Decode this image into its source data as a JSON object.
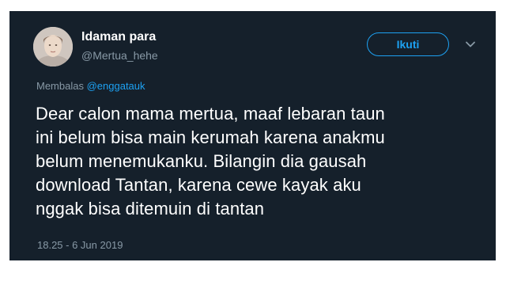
{
  "user": {
    "display_name": "Idaman para",
    "handle": "@Mertua_hehe"
  },
  "follow_button": {
    "label": "Ikuti"
  },
  "menu": {
    "icon": "chevron-down-icon"
  },
  "reply": {
    "prefix": "Membalas",
    "mention": "@enggatauk"
  },
  "tweet": {
    "text": "Dear calon mama mertua, maaf lebaran taun\nini belum bisa main kerumah karena anakmu\nbelum menemukanku. Bilangin dia gausah\ndownload Tantan, karena cewe kayak aku\nnggak bisa ditemuin di tantan",
    "timestamp": "18.25 - 6 Jun 2019"
  },
  "colors": {
    "background": "#15202b",
    "accent": "#1da1f2",
    "secondary_text": "#8899a6",
    "primary_text": "#ffffff"
  }
}
